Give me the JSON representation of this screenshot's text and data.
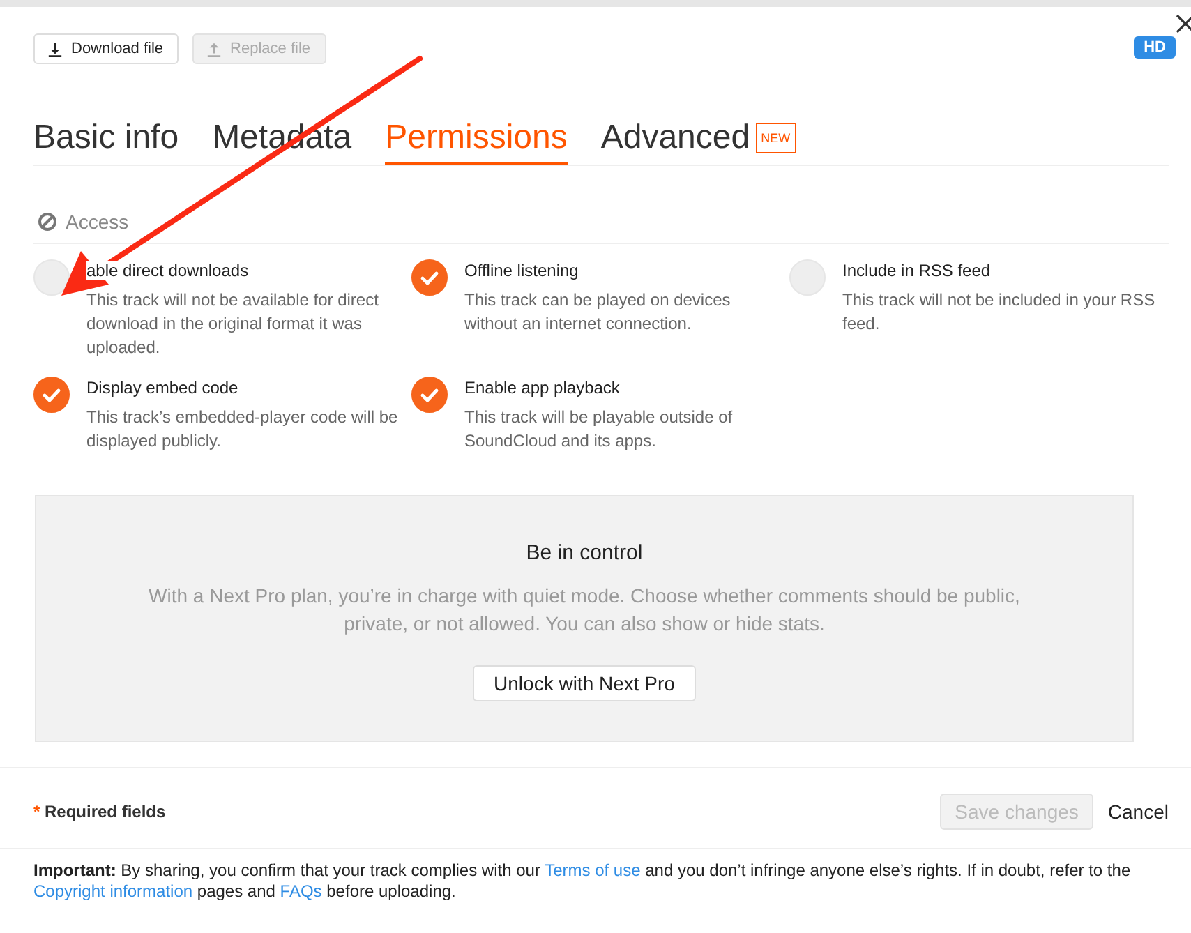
{
  "toolbar": [
    {
      "kind": "download",
      "label": "Download file",
      "disabled": false
    },
    {
      "kind": "upload",
      "label": "Replace file",
      "disabled": true
    }
  ],
  "quality_badge": "HD",
  "tabs": [
    {
      "label": "Basic info",
      "selected": false
    },
    {
      "label": "Metadata",
      "selected": false
    },
    {
      "label": "Permissions",
      "selected": true
    },
    {
      "label": "Advanced",
      "selected": false,
      "badge": "NEW"
    }
  ],
  "section": {
    "title": "Access",
    "options": [
      {
        "label": "able direct downloads",
        "description": "This track will not be available for direct download in the original format it was uploaded.",
        "checked": false
      },
      {
        "label": "Offline listening",
        "description": "This track can be played on devices without an internet connection.",
        "checked": true
      },
      {
        "label": "Include in RSS feed",
        "description": "This track will not be included in your RSS feed.",
        "checked": false
      },
      {
        "label": "Display embed code",
        "description": "This track’s embedded-player code will be displayed publicly.",
        "checked": true
      },
      {
        "label": "Enable app playback",
        "description": "This track will be playable outside of SoundCloud and its apps.",
        "checked": true
      }
    ]
  },
  "promo": {
    "title": "Be in control",
    "text": "With a Next Pro plan, you’re in charge with quiet mode. Choose whether comments should be public, private, or not allowed. You can also show or hide stats.",
    "button": "Unlock with Next Pro"
  },
  "footer": {
    "required_mark": "*",
    "required_label": "Required fields",
    "save": {
      "label": "Save changes",
      "disabled": true
    },
    "cancel": "Cancel"
  },
  "notice": [
    {
      "kind": "bold",
      "text": "Important:"
    },
    {
      "kind": "text",
      "text": " By sharing, you confirm that your track complies with our "
    },
    {
      "kind": "link",
      "text": "Terms of use"
    },
    {
      "kind": "text",
      "text": " and you don’t infringe anyone else’s rights. If in doubt, refer to the "
    },
    {
      "kind": "link",
      "text": "Copyright information"
    },
    {
      "kind": "text",
      "text": " pages and "
    },
    {
      "kind": "link",
      "text": "FAQs"
    },
    {
      "kind": "text",
      "text": " before uploading."
    }
  ]
}
